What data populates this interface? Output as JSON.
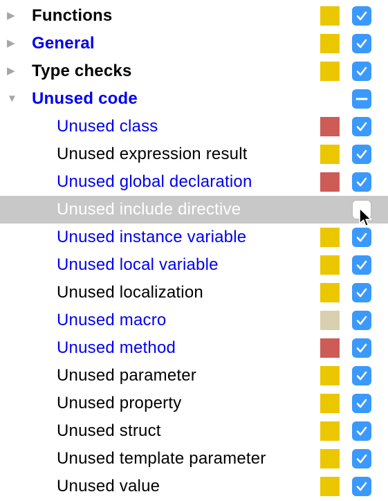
{
  "colors": {
    "link_blue": "#0000ee",
    "text_black": "#000000",
    "checkbox_blue": "#3b99fc",
    "selection_gray": "#c8c8c8",
    "severity_warning_yellow": "#ebc700",
    "severity_error_red": "#cd5c57",
    "severity_weak_tan": "#d9d0af"
  },
  "tree": {
    "groups": [
      {
        "label": "Functions",
        "expanded": false,
        "arrow_icon": "triangle-right-icon",
        "color": "black",
        "severity": "warning",
        "swatch": "#ebc700",
        "checkbox": "checked"
      },
      {
        "label": "General",
        "expanded": false,
        "arrow_icon": "triangle-right-icon",
        "color": "blue",
        "severity": "warning",
        "swatch": "#ebc700",
        "checkbox": "checked"
      },
      {
        "label": "Type checks",
        "expanded": false,
        "arrow_icon": "triangle-right-icon",
        "color": "black",
        "severity": "warning",
        "swatch": "#ebc700",
        "checkbox": "checked"
      },
      {
        "label": "Unused code",
        "expanded": true,
        "arrow_icon": "triangle-down-icon",
        "color": "blue",
        "severity": null,
        "swatch": null,
        "checkbox": "mixed",
        "children": [
          {
            "label": "Unused class",
            "color": "blue",
            "severity": "error",
            "swatch": "#cd5c57",
            "checkbox": "checked"
          },
          {
            "label": "Unused expression result",
            "color": "black",
            "severity": "warning",
            "swatch": "#ebc700",
            "checkbox": "checked"
          },
          {
            "label": "Unused global declaration",
            "color": "blue",
            "severity": "error",
            "swatch": "#cd5c57",
            "checkbox": "checked"
          },
          {
            "label": "Unused include directive",
            "color": "black",
            "severity": null,
            "swatch": null,
            "checkbox": "unchecked",
            "selected": true
          },
          {
            "label": "Unused instance variable",
            "color": "blue",
            "severity": "warning",
            "swatch": "#ebc700",
            "checkbox": "checked"
          },
          {
            "label": "Unused local variable",
            "color": "blue",
            "severity": "warning",
            "swatch": "#ebc700",
            "checkbox": "checked"
          },
          {
            "label": "Unused localization",
            "color": "black",
            "severity": "warning",
            "swatch": "#ebc700",
            "checkbox": "checked"
          },
          {
            "label": "Unused macro",
            "color": "blue",
            "severity": "weak-warning",
            "swatch": "#d9d0af",
            "checkbox": "checked"
          },
          {
            "label": "Unused method",
            "color": "blue",
            "severity": "error",
            "swatch": "#cd5c57",
            "checkbox": "checked"
          },
          {
            "label": "Unused parameter",
            "color": "black",
            "severity": "warning",
            "swatch": "#ebc700",
            "checkbox": "checked"
          },
          {
            "label": "Unused property",
            "color": "black",
            "severity": "warning",
            "swatch": "#ebc700",
            "checkbox": "checked"
          },
          {
            "label": "Unused struct",
            "color": "black",
            "severity": "warning",
            "swatch": "#ebc700",
            "checkbox": "checked"
          },
          {
            "label": "Unused template parameter",
            "color": "black",
            "severity": "warning",
            "swatch": "#ebc700",
            "checkbox": "checked"
          },
          {
            "label": "Unused value",
            "color": "black",
            "severity": "warning",
            "swatch": "#ebc700",
            "checkbox": "checked"
          }
        ]
      }
    ]
  },
  "cursor_icon": "mouse-pointer-icon"
}
